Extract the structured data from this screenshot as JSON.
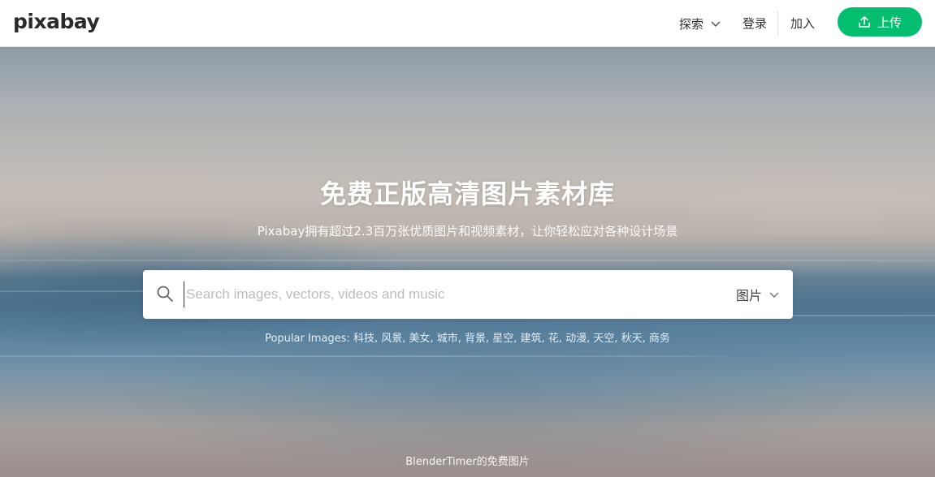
{
  "header": {
    "logo": "pixabay",
    "explore_label": "探索",
    "login_label": "登录",
    "join_label": "加入",
    "upload_label": "上传",
    "upload_color": "#02be6e"
  },
  "hero": {
    "title": "免费正版高清图片素材库",
    "subtitle": "Pixabay拥有超过2.3百万张优质图片和视频素材，让你轻松应对各种设计场景",
    "search": {
      "placeholder": "Search images, vectors, videos and music",
      "value": "",
      "type_selected": "图片"
    },
    "popular": "Popular Images: 科技, 风景, 美女, 城市, 背景, 星空, 建筑, 花, 动漫, 天空, 秋天, 商务",
    "credit": "BlenderTimer的免费图片"
  },
  "icons": {
    "search": "search-icon",
    "chevron": "chevron-down-icon",
    "upload": "upload-icon"
  }
}
